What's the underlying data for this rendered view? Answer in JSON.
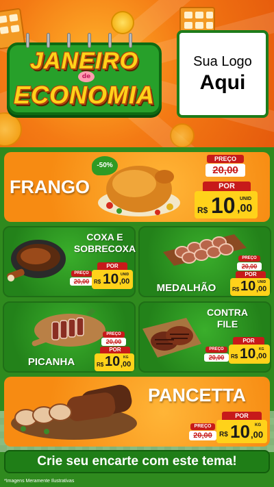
{
  "header": {
    "title_line1": "JANEIRO",
    "title_de": "de",
    "title_line2": "ECONOMIA",
    "logo_line1": "Sua Logo",
    "logo_line2": "Aqui"
  },
  "colors": {
    "orange": "#f78b12",
    "green": "#2f8a1e",
    "red_tag": "#c71a1a",
    "price_yellow": "#ffd21a"
  },
  "products": {
    "frango": {
      "name": "FRANGO",
      "discount": "-50%",
      "preco_label": "PREÇO",
      "old_price": "20,00",
      "por_label": "POR",
      "currency": "R$",
      "price_int": "10",
      "price_dec": ",00",
      "unit": "UNID"
    },
    "coxa": {
      "name_l1": "COXA E",
      "name_l2": "SOBRECOXA",
      "preco_label": "PREÇO",
      "old_price": "20,00",
      "por_label": "POR",
      "currency": "R$",
      "price_int": "10",
      "price_dec": ",00",
      "unit": "UNID"
    },
    "medalhao": {
      "name": "MEDALHÃO",
      "preco_label": "PREÇO",
      "old_price": "20,00",
      "por_label": "POR",
      "currency": "R$",
      "price_int": "10",
      "price_dec": ",00",
      "unit": "UNID"
    },
    "picanha": {
      "name": "PICANHA",
      "preco_label": "PREÇO",
      "old_price": "20,00",
      "por_label": "POR",
      "currency": "R$",
      "price_int": "10",
      "price_dec": ",00",
      "unit": "KG"
    },
    "contrafile": {
      "name_l1": "CONTRA",
      "name_l2": "FILE",
      "preco_label": "PREÇO",
      "old_price": "20,00",
      "por_label": "POR",
      "currency": "R$",
      "price_int": "10",
      "price_dec": ",00",
      "unit": "KG"
    },
    "pancetta": {
      "name": "PANCETTA",
      "preco_label": "PREÇO",
      "old_price": "20,00",
      "por_label": "POR",
      "currency": "R$",
      "price_int": "10",
      "price_dec": ",00",
      "unit": "KG"
    }
  },
  "cta": "Crie seu encarte com este tema!",
  "footnote": "*Imagens Meramente Ilustrativas"
}
